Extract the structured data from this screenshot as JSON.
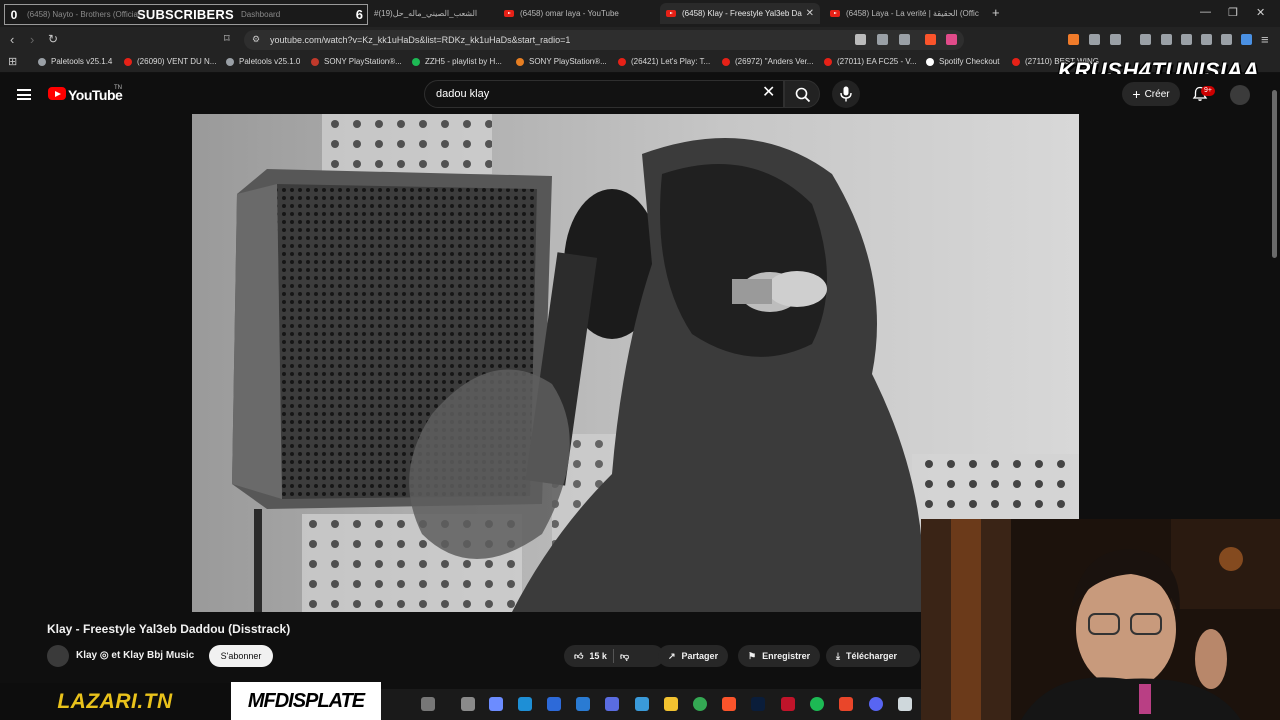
{
  "browser": {
    "tabs": [
      {
        "label": "(6458) Nayto - Brothers (Official"
      },
      {
        "label": "Dashboard"
      },
      {
        "label": "#الشعب_الصيني_ماله_حل(19)"
      },
      {
        "label": "(6458) omar laya - YouTube"
      },
      {
        "label": "(6458) Klay - Freestyle Yal3eb Da",
        "active": true
      },
      {
        "label": "(6458) Laya - La verité | الحقيقة (Offic"
      }
    ],
    "overlay": {
      "left_count": "0",
      "label": "SUBSCRIBERS",
      "right_count": "6"
    },
    "url": "youtube.com/watch?v=Kz_kk1uHaDs&list=RDKz_kk1uHaDs&start_radio=1",
    "bookmarks": [
      {
        "label": "Paletools v25.1.4",
        "color": "#9aa0a6"
      },
      {
        "label": "(26090) VENT DU N...",
        "color": "#e62117"
      },
      {
        "label": "Paletools v25.1.0",
        "color": "#9aa0a6"
      },
      {
        "label": "SONY PlayStation®...",
        "color": "#c0392b"
      },
      {
        "label": "ZZH5 - playlist by H...",
        "color": "#1db954"
      },
      {
        "label": "SONY PlayStation®...",
        "color": "#e67e22"
      },
      {
        "label": "(26421) Let's Play: T...",
        "color": "#e62117"
      },
      {
        "label": "(26972) \"Anders Ver...",
        "color": "#e62117"
      },
      {
        "label": "(27011) EA FC25 - V...",
        "color": "#e62117"
      },
      {
        "label": "Spotify Checkout",
        "color": "#ffffff"
      },
      {
        "label": "(27110) BEST WING",
        "color": "#e62117"
      }
    ],
    "stream_overlay": "KRUSH4TUNISIAA"
  },
  "youtube": {
    "logo_text": "YouTube",
    "logo_region": "TN",
    "search_value": "dadou klay",
    "create_label": "Créer",
    "notif_badge": "9+"
  },
  "video": {
    "title": "Klay - Freestyle Yal3eb Daddou (Disstrack)",
    "channel": "Klay ◎ et Klay Bbj Music",
    "subscribe_label": "S'abonner",
    "likes": "15 k",
    "share_label": "Partager",
    "save_label": "Enregistrer",
    "download_label": "Télécharger"
  },
  "overlays": {
    "lazari": "LAZARI.TN",
    "mfd": "MFDISPLATE"
  },
  "colors": {
    "bg": "#0f0f0f",
    "youtube_red": "#ff0000",
    "lazari_yellow": "#e9c21b"
  }
}
